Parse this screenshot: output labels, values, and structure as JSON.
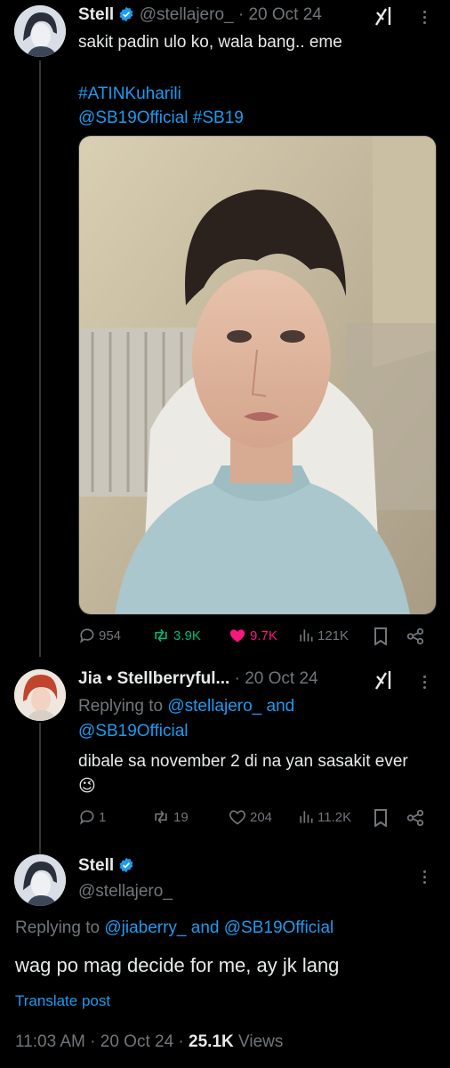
{
  "tweet1": {
    "name": "Stell",
    "handle": "@stellajero_",
    "dot_time": "· 20 Oct 24",
    "text": "sakit padin ulo ko, wala bang.. eme",
    "hashtag1": "#ATINKuharili",
    "mention": "@SB19Official",
    "hashtag2": "#SB19",
    "replies": "954",
    "retweets": "3.9K",
    "likes": "9.7K",
    "views": "121K"
  },
  "reply1": {
    "name": "Jia • Stellberryful...",
    "dot_time": "· 20 Oct 24",
    "replying_prefix": "Replying to",
    "replying_to": "@stellajero_",
    "replying_and": "and",
    "replying_to2": "@SB19Official",
    "text": "dibale sa november 2 di na yan sasakit ever",
    "emoji": "😉",
    "replies": "1",
    "retweets": "19",
    "likes": "204",
    "views": "11.2K"
  },
  "reply2": {
    "name": "Stell",
    "handle": "@stellajero_",
    "replying_prefix": "Replying to",
    "replying_to": "@jiaberry_",
    "replying_and": "and",
    "replying_to2": "@SB19Official",
    "text": "wag po mag decide for me, ay jk lang",
    "translate": "Translate post",
    "time": "11:03 AM · 20 Oct 24 ·",
    "views_count": "25.1K",
    "views_label": "Views"
  },
  "colors": {
    "accent": "#1d9bf0",
    "retweet": "#00ba7c",
    "like": "#f91880",
    "muted": "#71767b"
  }
}
